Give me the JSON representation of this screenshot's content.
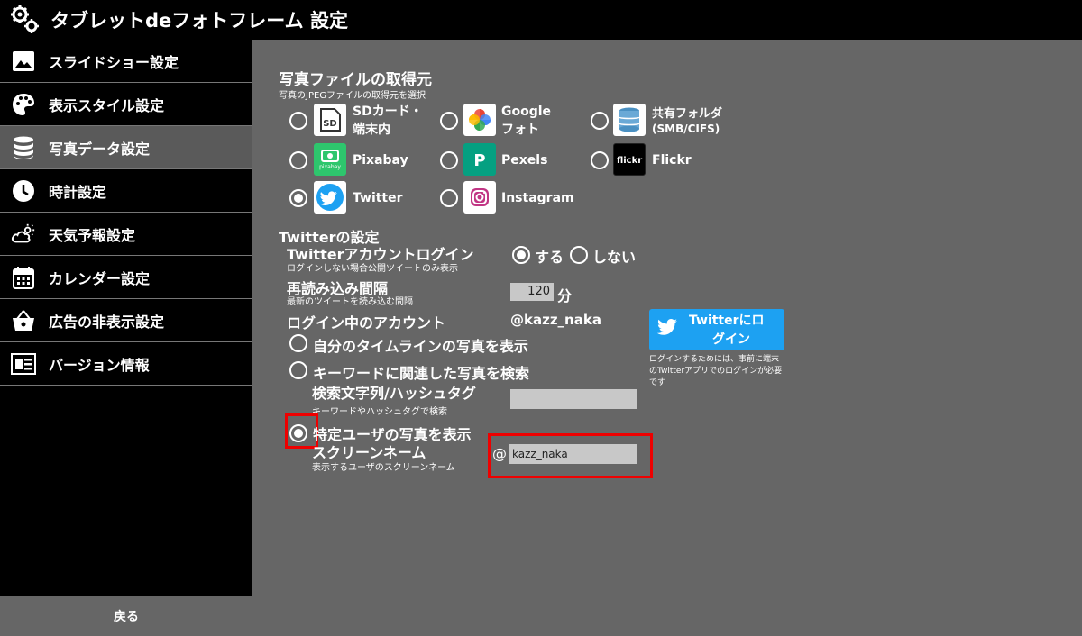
{
  "app": {
    "title": "タブレットdeフォトフレーム 設定"
  },
  "sidebar": {
    "items": [
      {
        "label": "スライドショー設定",
        "icon": "image-icon"
      },
      {
        "label": "表示スタイル設定",
        "icon": "palette-icon"
      },
      {
        "label": "写真データ設定",
        "icon": "database-icon",
        "active": true
      },
      {
        "label": "時計設定",
        "icon": "clock-icon"
      },
      {
        "label": "天気予報設定",
        "icon": "weather-icon"
      },
      {
        "label": "カレンダー設定",
        "icon": "calendar-icon"
      },
      {
        "label": "広告の非表示設定",
        "icon": "basket-icon"
      },
      {
        "label": "バージョン情報",
        "icon": "info-card-icon"
      }
    ],
    "back_label": "戻る"
  },
  "source": {
    "title": "写真ファイルの取得元",
    "subtitle": "写真のJPEGファイルの取得元を選択",
    "options": [
      {
        "label_line1": "SDカード・",
        "label_line2": "端末内",
        "icon_text": "SD",
        "selected": false
      },
      {
        "label_line1": "Google",
        "label_line2": "フォト",
        "selected": false
      },
      {
        "label_line1": "共有フォルダ",
        "label_line2": "(SMB/CIFS)",
        "selected": false
      },
      {
        "label": "Pixabay",
        "icon_text": "pixabay",
        "selected": false
      },
      {
        "label": "Pexels",
        "icon_text": "P",
        "selected": false
      },
      {
        "label": "Flickr",
        "icon_text": "flickr",
        "selected": false
      },
      {
        "label": "Twitter",
        "selected": true
      },
      {
        "label": "Instagram",
        "selected": false
      }
    ]
  },
  "twitter": {
    "section_title": "Twitterの設定",
    "login": {
      "title": "Twitterアカウントログイン",
      "subtitle": "ログインしない場合公開ツイートのみ表示",
      "yes_label": "する",
      "no_label": "しない",
      "selected": "yes"
    },
    "reload": {
      "title": "再読み込み間隔",
      "subtitle": "最新のツイートを読み込む間隔",
      "value": "120",
      "unit": "分"
    },
    "account": {
      "title": "ログイン中のアカウント",
      "value": "@kazz_naka"
    },
    "login_button": {
      "line1": "Twitterにロ",
      "line2": "グイン"
    },
    "login_note": "ログインするためには、事前に端末のTwitterアプリでのログインが必要です",
    "modes": {
      "timeline": "自分のタイムラインの写真を表示",
      "keyword": "キーワードに関連した写真を検索",
      "user": "特定ユーザの写真を表示",
      "selected": "user"
    },
    "search": {
      "title": "検索文字列/ハッシュタグ",
      "subtitle": "キーワードやハッシュタグで検索",
      "value": ""
    },
    "screen_name": {
      "title": "スクリーンネーム",
      "subtitle": "表示するユーザのスクリーンネーム",
      "at": "@",
      "value": "kazz_naka"
    }
  },
  "colors": {
    "twitter_blue": "#1da1f2",
    "highlight_red": "#e00000",
    "main_bg": "#666666",
    "sidebar_bg": "#000000"
  }
}
